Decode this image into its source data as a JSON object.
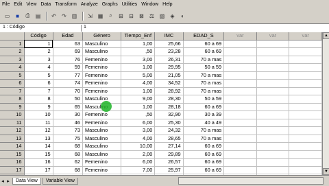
{
  "menu": [
    "File",
    "Edit",
    "View",
    "Data",
    "Transform",
    "Analyze",
    "Graphs",
    "Utilities",
    "Window",
    "Help"
  ],
  "cellbar": {
    "ref": "1 : Código",
    "value": "1"
  },
  "columns": [
    "Código",
    "Edad",
    "Género",
    "Tiempo_Enf",
    "IMC",
    "EDAD_S",
    "var",
    "var",
    "var"
  ],
  "rows": [
    [
      "1",
      "1",
      "63",
      "Masculino",
      "1,00",
      "25,66",
      "60 a 69"
    ],
    [
      "2",
      "2",
      "69",
      "Masculino",
      ",50",
      "23,28",
      "60 a 69"
    ],
    [
      "3",
      "3",
      "76",
      "Femenino",
      "3,00",
      "26,31",
      "70 a mas"
    ],
    [
      "4",
      "4",
      "59",
      "Femenino",
      "1,00",
      "29,95",
      "50 a 59"
    ],
    [
      "5",
      "5",
      "77",
      "Femenino",
      "5,00",
      "21,05",
      "70 a mas"
    ],
    [
      "6",
      "6",
      "74",
      "Femenino",
      "4,00",
      "34,52",
      "70 a mas"
    ],
    [
      "7",
      "7",
      "70",
      "Femenino",
      "1,00",
      "28,92",
      "70 a mas"
    ],
    [
      "8",
      "8",
      "50",
      "Masculino",
      "9,00",
      "28,30",
      "50 a 59"
    ],
    [
      "9",
      "9",
      "65",
      "Masculino",
      "1,00",
      "28,18",
      "60 a 69"
    ],
    [
      "10",
      "10",
      "30",
      "Femenino",
      ",50",
      "32,90",
      "30 a 39"
    ],
    [
      "11",
      "11",
      "46",
      "Femenino",
      "6,00",
      "25,30",
      "40 a 49"
    ],
    [
      "12",
      "12",
      "73",
      "Masculino",
      "3,00",
      "24,32",
      "70 a mas"
    ],
    [
      "13",
      "13",
      "75",
      "Masculino",
      "4,00",
      "28,65",
      "70 a mas"
    ],
    [
      "14",
      "14",
      "68",
      "Masculino",
      "10,00",
      "27,14",
      "60 a 69"
    ],
    [
      "15",
      "15",
      "68",
      "Masculino",
      "2,00",
      "29,89",
      "60 a 69"
    ],
    [
      "16",
      "16",
      "62",
      "Femenino",
      "6,00",
      "26,57",
      "60 a 69"
    ],
    [
      "17",
      "17",
      "68",
      "Femenino",
      "7,00",
      "25,97",
      "60 a 69"
    ],
    [
      "18",
      "18",
      "68",
      "Femenino",
      "20,00",
      "21,64",
      "60 a 69"
    ]
  ],
  "tabs": {
    "data_view": "Data View",
    "variable_view": "Variable View"
  }
}
